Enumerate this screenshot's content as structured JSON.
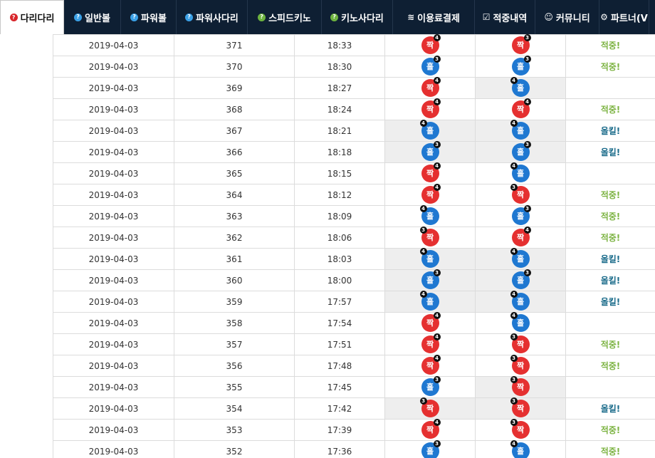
{
  "colors": {
    "nav_bg": "#0e1f33",
    "ball_red": "#e53030",
    "ball_blue": "#1f78d1",
    "result_hit": "#7cb342",
    "result_allkill": "#1a6b8a",
    "shade": "#eeeeee"
  },
  "nav": [
    {
      "label": "다리다리",
      "icon": "question-circle-icon",
      "icon_color": "red",
      "active": true,
      "glyph": "?"
    },
    {
      "label": "일반볼",
      "icon": "question-circle-icon",
      "icon_color": "blue",
      "glyph": "?"
    },
    {
      "label": "파워볼",
      "icon": "question-circle-icon",
      "icon_color": "blue",
      "glyph": "?"
    },
    {
      "label": "파워사다리",
      "icon": "question-circle-icon",
      "icon_color": "blue",
      "glyph": "?"
    },
    {
      "label": "스피드키노",
      "icon": "question-circle-icon",
      "icon_color": "green",
      "glyph": "?"
    },
    {
      "label": "키노사다리",
      "icon": "question-circle-icon",
      "icon_color": "green",
      "glyph": "?"
    },
    {
      "label": "이용료결제",
      "icon": "database-icon",
      "icon_color": "glyph",
      "glyph": "≋"
    },
    {
      "label": "적중내역",
      "icon": "checkbox-icon",
      "icon_color": "glyph",
      "glyph": "☑"
    },
    {
      "label": "커뮤니티",
      "icon": "smile-icon",
      "icon_color": "glyph",
      "glyph": "☺"
    },
    {
      "label": "파트너(V",
      "icon": "cogs-icon",
      "icon_color": "glyph",
      "glyph": "⚙"
    }
  ],
  "rows": [
    {
      "date": "2019-04-03",
      "round": "371",
      "time": "18:33",
      "result": {
        "label": "짝",
        "color": "red",
        "badge": "4",
        "badge_pos": "right"
      },
      "pick": {
        "label": "짝",
        "color": "red",
        "badge": "3",
        "badge_pos": "right"
      },
      "status": "적중!",
      "status_type": "hit",
      "shade": false
    },
    {
      "date": "2019-04-03",
      "round": "370",
      "time": "18:30",
      "result": {
        "label": "홀",
        "color": "blue",
        "badge": "3",
        "badge_pos": "right"
      },
      "pick": {
        "label": "홀",
        "color": "blue",
        "badge": "3",
        "badge_pos": "right"
      },
      "status": "적중!",
      "status_type": "hit",
      "shade": false
    },
    {
      "date": "2019-04-03",
      "round": "369",
      "time": "18:27",
      "result": {
        "label": "짝",
        "color": "red",
        "badge": "4",
        "badge_pos": "right"
      },
      "pick": {
        "label": "홀",
        "color": "blue",
        "badge": "4",
        "badge_pos": "left"
      },
      "status": "",
      "status_type": "",
      "shade": false,
      "pick_shade": true
    },
    {
      "date": "2019-04-03",
      "round": "368",
      "time": "18:24",
      "result": {
        "label": "짝",
        "color": "red",
        "badge": "4",
        "badge_pos": "right"
      },
      "pick": {
        "label": "짝",
        "color": "red",
        "badge": "4",
        "badge_pos": "right"
      },
      "status": "적중!",
      "status_type": "hit",
      "shade": false
    },
    {
      "date": "2019-04-03",
      "round": "367",
      "time": "18:21",
      "result": {
        "label": "홀",
        "color": "blue",
        "badge": "4",
        "badge_pos": "left"
      },
      "pick": {
        "label": "홀",
        "color": "blue",
        "badge": "4",
        "badge_pos": "left"
      },
      "status": "올킬!",
      "status_type": "allkill",
      "shade": true
    },
    {
      "date": "2019-04-03",
      "round": "366",
      "time": "18:18",
      "result": {
        "label": "홀",
        "color": "blue",
        "badge": "3",
        "badge_pos": "right"
      },
      "pick": {
        "label": "홀",
        "color": "blue",
        "badge": "3",
        "badge_pos": "right"
      },
      "status": "올킬!",
      "status_type": "allkill",
      "shade": true
    },
    {
      "date": "2019-04-03",
      "round": "365",
      "time": "18:15",
      "result": {
        "label": "짝",
        "color": "red",
        "badge": "4",
        "badge_pos": "right"
      },
      "pick": {
        "label": "홀",
        "color": "blue",
        "badge": "4",
        "badge_pos": "left"
      },
      "status": "",
      "status_type": "",
      "shade": false
    },
    {
      "date": "2019-04-03",
      "round": "364",
      "time": "18:12",
      "result": {
        "label": "짝",
        "color": "red",
        "badge": "4",
        "badge_pos": "right"
      },
      "pick": {
        "label": "짝",
        "color": "red",
        "badge": "3",
        "badge_pos": "left"
      },
      "status": "적중!",
      "status_type": "hit",
      "shade": false
    },
    {
      "date": "2019-04-03",
      "round": "363",
      "time": "18:09",
      "result": {
        "label": "홀",
        "color": "blue",
        "badge": "4",
        "badge_pos": "left"
      },
      "pick": {
        "label": "홀",
        "color": "blue",
        "badge": "3",
        "badge_pos": "right"
      },
      "status": "적중!",
      "status_type": "hit",
      "shade": false
    },
    {
      "date": "2019-04-03",
      "round": "362",
      "time": "18:06",
      "result": {
        "label": "짝",
        "color": "red",
        "badge": "3",
        "badge_pos": "left"
      },
      "pick": {
        "label": "짝",
        "color": "red",
        "badge": "4",
        "badge_pos": "right"
      },
      "status": "적중!",
      "status_type": "hit",
      "shade": false
    },
    {
      "date": "2019-04-03",
      "round": "361",
      "time": "18:03",
      "result": {
        "label": "홀",
        "color": "blue",
        "badge": "4",
        "badge_pos": "left"
      },
      "pick": {
        "label": "홀",
        "color": "blue",
        "badge": "4",
        "badge_pos": "left"
      },
      "status": "올킬!",
      "status_type": "allkill",
      "shade": true
    },
    {
      "date": "2019-04-03",
      "round": "360",
      "time": "18:00",
      "result": {
        "label": "홀",
        "color": "blue",
        "badge": "3",
        "badge_pos": "right"
      },
      "pick": {
        "label": "홀",
        "color": "blue",
        "badge": "3",
        "badge_pos": "right"
      },
      "status": "올킬!",
      "status_type": "allkill",
      "shade": true
    },
    {
      "date": "2019-04-03",
      "round": "359",
      "time": "17:57",
      "result": {
        "label": "홀",
        "color": "blue",
        "badge": "4",
        "badge_pos": "left"
      },
      "pick": {
        "label": "홀",
        "color": "blue",
        "badge": "4",
        "badge_pos": "left"
      },
      "status": "올킬!",
      "status_type": "allkill",
      "shade": true
    },
    {
      "date": "2019-04-03",
      "round": "358",
      "time": "17:54",
      "result": {
        "label": "짝",
        "color": "red",
        "badge": "4",
        "badge_pos": "right"
      },
      "pick": {
        "label": "홀",
        "color": "blue",
        "badge": "4",
        "badge_pos": "left"
      },
      "status": "",
      "status_type": "",
      "shade": false
    },
    {
      "date": "2019-04-03",
      "round": "357",
      "time": "17:51",
      "result": {
        "label": "짝",
        "color": "red",
        "badge": "4",
        "badge_pos": "right"
      },
      "pick": {
        "label": "짝",
        "color": "red",
        "badge": "3",
        "badge_pos": "left"
      },
      "status": "적중!",
      "status_type": "hit",
      "shade": false
    },
    {
      "date": "2019-04-03",
      "round": "356",
      "time": "17:48",
      "result": {
        "label": "짝",
        "color": "red",
        "badge": "4",
        "badge_pos": "right"
      },
      "pick": {
        "label": "짝",
        "color": "red",
        "badge": "3",
        "badge_pos": "left"
      },
      "status": "적중!",
      "status_type": "hit",
      "shade": false
    },
    {
      "date": "2019-04-03",
      "round": "355",
      "time": "17:45",
      "result": {
        "label": "홀",
        "color": "blue",
        "badge": "3",
        "badge_pos": "right"
      },
      "pick": {
        "label": "짝",
        "color": "red",
        "badge": "3",
        "badge_pos": "left"
      },
      "status": "",
      "status_type": "",
      "shade": false,
      "pick_shade": true
    },
    {
      "date": "2019-04-03",
      "round": "354",
      "time": "17:42",
      "result": {
        "label": "짝",
        "color": "red",
        "badge": "3",
        "badge_pos": "left"
      },
      "pick": {
        "label": "짝",
        "color": "red",
        "badge": "3",
        "badge_pos": "left"
      },
      "status": "올킬!",
      "status_type": "allkill",
      "shade": true
    },
    {
      "date": "2019-04-03",
      "round": "353",
      "time": "17:39",
      "result": {
        "label": "짝",
        "color": "red",
        "badge": "4",
        "badge_pos": "right"
      },
      "pick": {
        "label": "짝",
        "color": "red",
        "badge": "3",
        "badge_pos": "left"
      },
      "status": "적중!",
      "status_type": "hit",
      "shade": false
    },
    {
      "date": "2019-04-03",
      "round": "352",
      "time": "17:36",
      "result": {
        "label": "홀",
        "color": "blue",
        "badge": "3",
        "badge_pos": "right"
      },
      "pick": {
        "label": "홀",
        "color": "blue",
        "badge": "4",
        "badge_pos": "left"
      },
      "status": "적중!",
      "status_type": "hit",
      "shade": false
    }
  ]
}
